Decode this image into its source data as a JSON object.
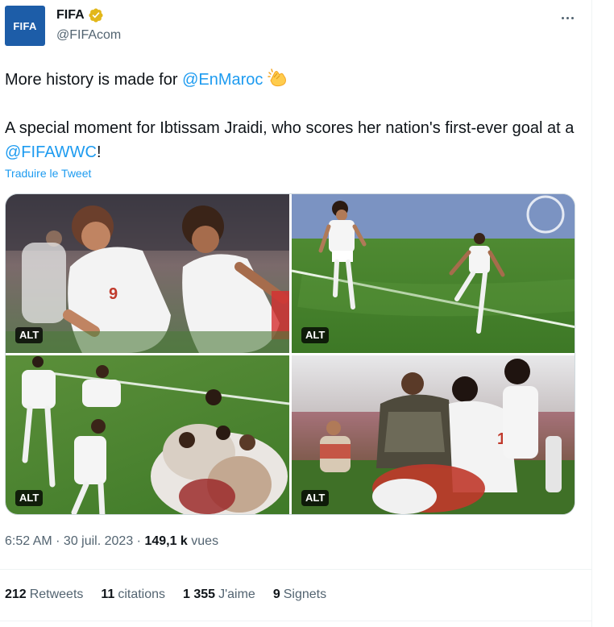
{
  "author": {
    "avatar_text": "FIFA",
    "name": "FIFA",
    "handle": "@FIFAcom",
    "verified_icon": "gold-verified-badge-icon"
  },
  "menu_icon": "more-options-icon",
  "tweet": {
    "line1_text": "More history is made for ",
    "line1_mention": "@EnMaroc",
    "line1_emoji": "clapping-hands-icon",
    "line2_text": "A special moment for Ibtissam Jraidi, who scores her nation's first-ever goal at a ",
    "line2_mention": "@FIFAWWC",
    "line2_end": "!"
  },
  "translate_label": "Traduire le Tweet",
  "media": [
    {
      "alt_label": "ALT"
    },
    {
      "alt_label": "ALT"
    },
    {
      "alt_label": "ALT"
    },
    {
      "alt_label": "ALT"
    }
  ],
  "meta": {
    "time": "6:52 AM",
    "separator": " · ",
    "date": "30 juil. 2023",
    "views_count": "149,1 k",
    "views_label": "vues"
  },
  "stats": {
    "retweets_count": "212",
    "retweets_label": "Retweets",
    "quotes_count": "11",
    "quotes_label": "citations",
    "likes_count": "1 355",
    "likes_label": "J'aime",
    "bookmarks_count": "9",
    "bookmarks_label": "Signets"
  },
  "colors": {
    "accent": "#1d9bf0",
    "text": "#0f1419",
    "secondary": "#536471",
    "avatar_bg": "#1d5da8",
    "verified": "#e2b719"
  }
}
